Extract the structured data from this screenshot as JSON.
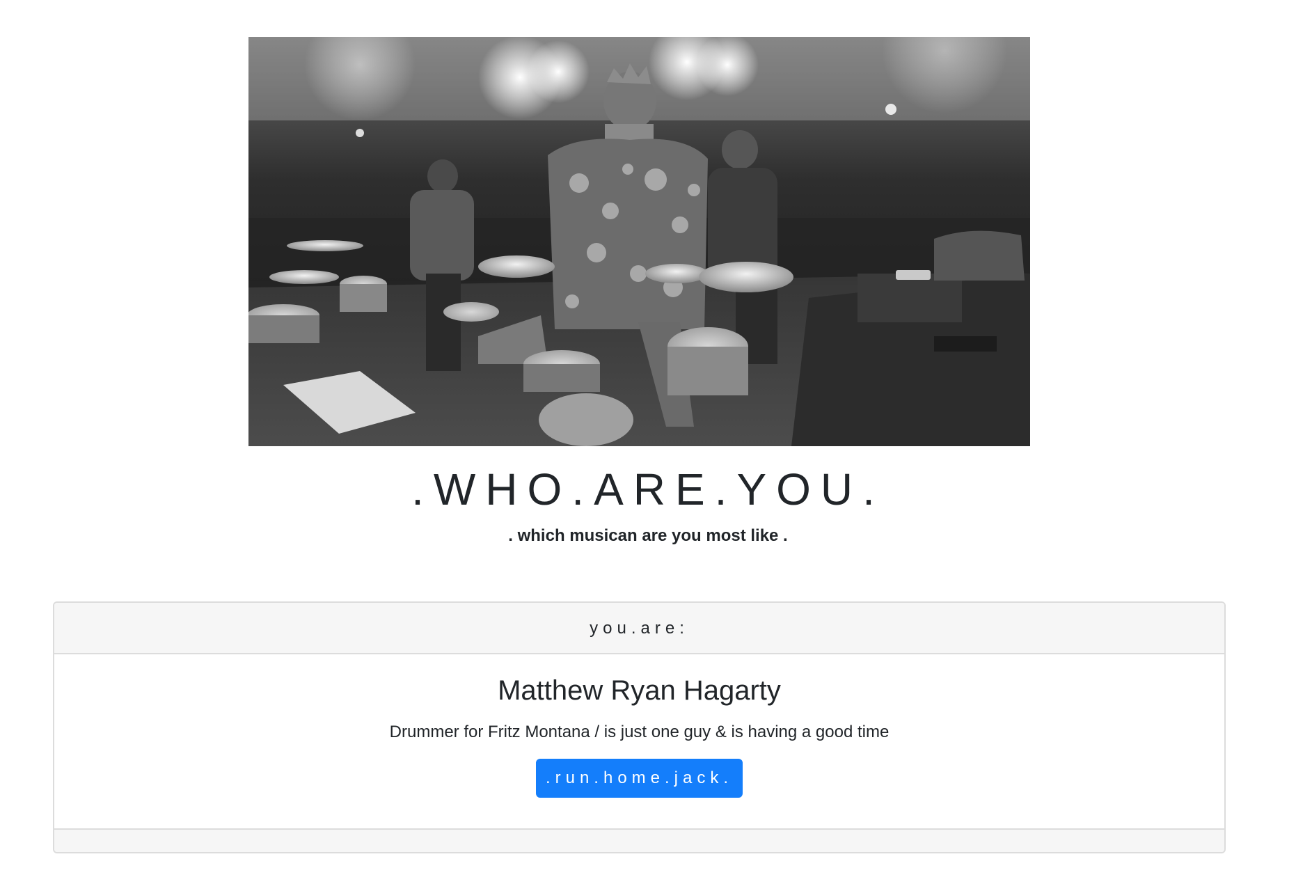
{
  "hero": {
    "alt": "Black and white photo of a drummer playing on stage with a band"
  },
  "header": {
    "title": ".WHO.ARE.YOU.",
    "subtitle": ". which musican are you most like ."
  },
  "result_card": {
    "header_label": "you.are:",
    "name": "Matthew Ryan Hagarty",
    "description": "Drummer for Fritz Montana / is just one guy & is having a good time",
    "button_label": ".run.home.jack."
  },
  "colors": {
    "accent": "#147efb",
    "card_header_bg": "#f6f6f6",
    "border": "#dcdcdc",
    "text": "#212529"
  }
}
